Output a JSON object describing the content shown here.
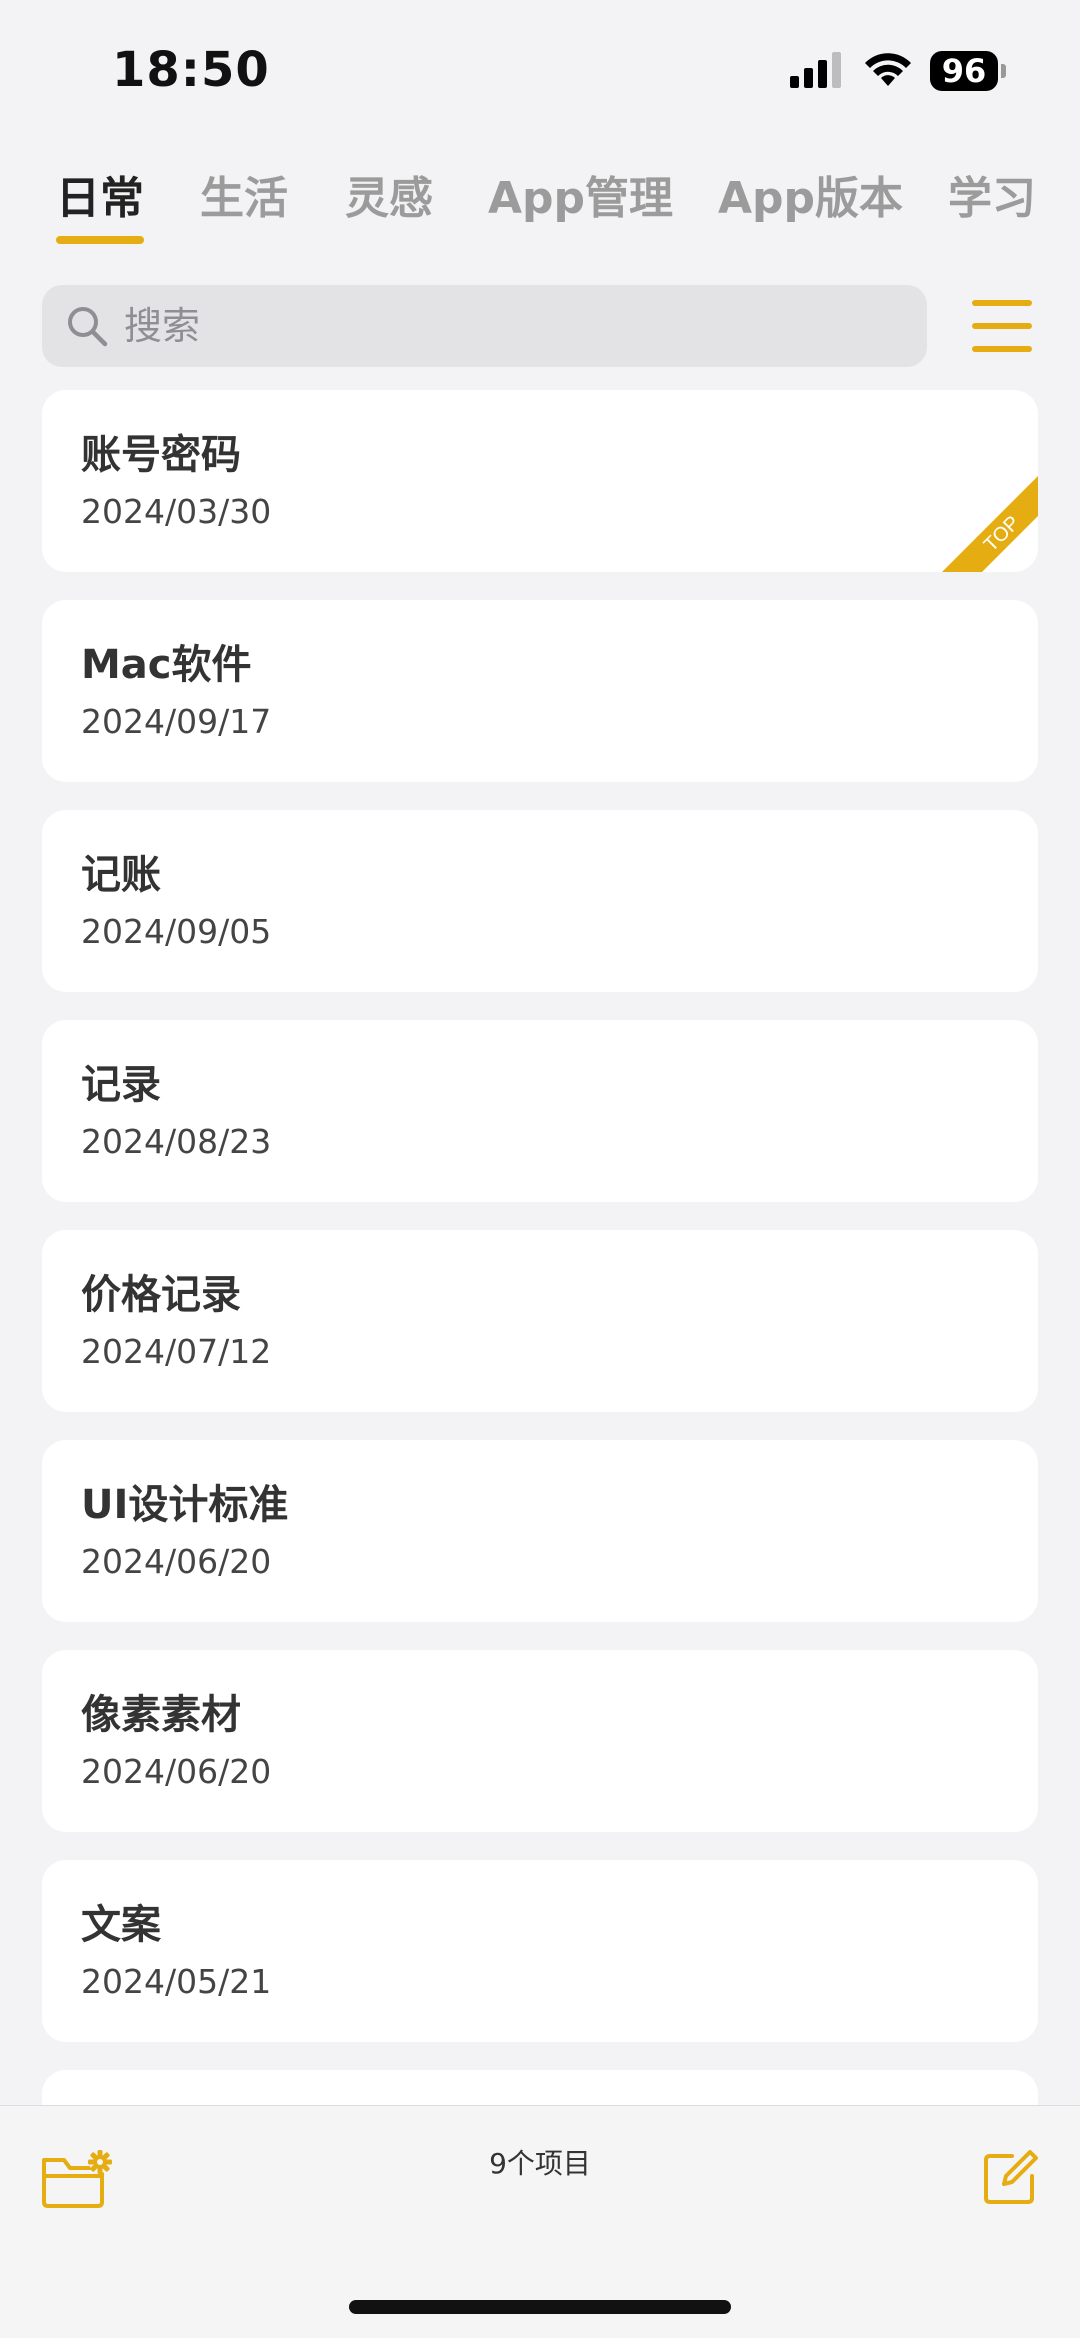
{
  "status_bar": {
    "time": "18:50",
    "battery": "96"
  },
  "tabs": [
    {
      "label": "日常",
      "active": true
    },
    {
      "label": "生活",
      "active": false
    },
    {
      "label": "灵感",
      "active": false
    },
    {
      "label": "App管理",
      "active": false
    },
    {
      "label": "App版本",
      "active": false
    },
    {
      "label": "学习",
      "active": false
    }
  ],
  "search": {
    "placeholder": "搜索",
    "value": ""
  },
  "notes": [
    {
      "title": "账号密码",
      "date": "2024/03/30",
      "pinned": true,
      "pin_label": "TOP"
    },
    {
      "title": "Mac软件",
      "date": "2024/09/17",
      "pinned": false
    },
    {
      "title": "记账",
      "date": "2024/09/05",
      "pinned": false
    },
    {
      "title": "记录",
      "date": "2024/08/23",
      "pinned": false
    },
    {
      "title": "价格记录",
      "date": "2024/07/12",
      "pinned": false
    },
    {
      "title": "UI设计标准",
      "date": "2024/06/20",
      "pinned": false
    },
    {
      "title": "像素素材",
      "date": "2024/06/20",
      "pinned": false
    },
    {
      "title": "文案",
      "date": "2024/05/21",
      "pinned": false
    },
    {
      "title": "",
      "date": "",
      "pinned": false
    }
  ],
  "bottom_bar": {
    "item_count": "9个项目"
  },
  "colors": {
    "accent": "#e6ad12",
    "background": "#f3f3f5",
    "card": "#ffffff"
  },
  "icons": {
    "signal": "cellular-signal-icon",
    "wifi": "wifi-icon",
    "search": "search-icon",
    "menu": "hamburger-menu-icon",
    "folder_settings": "folder-settings-icon",
    "compose": "compose-icon"
  }
}
